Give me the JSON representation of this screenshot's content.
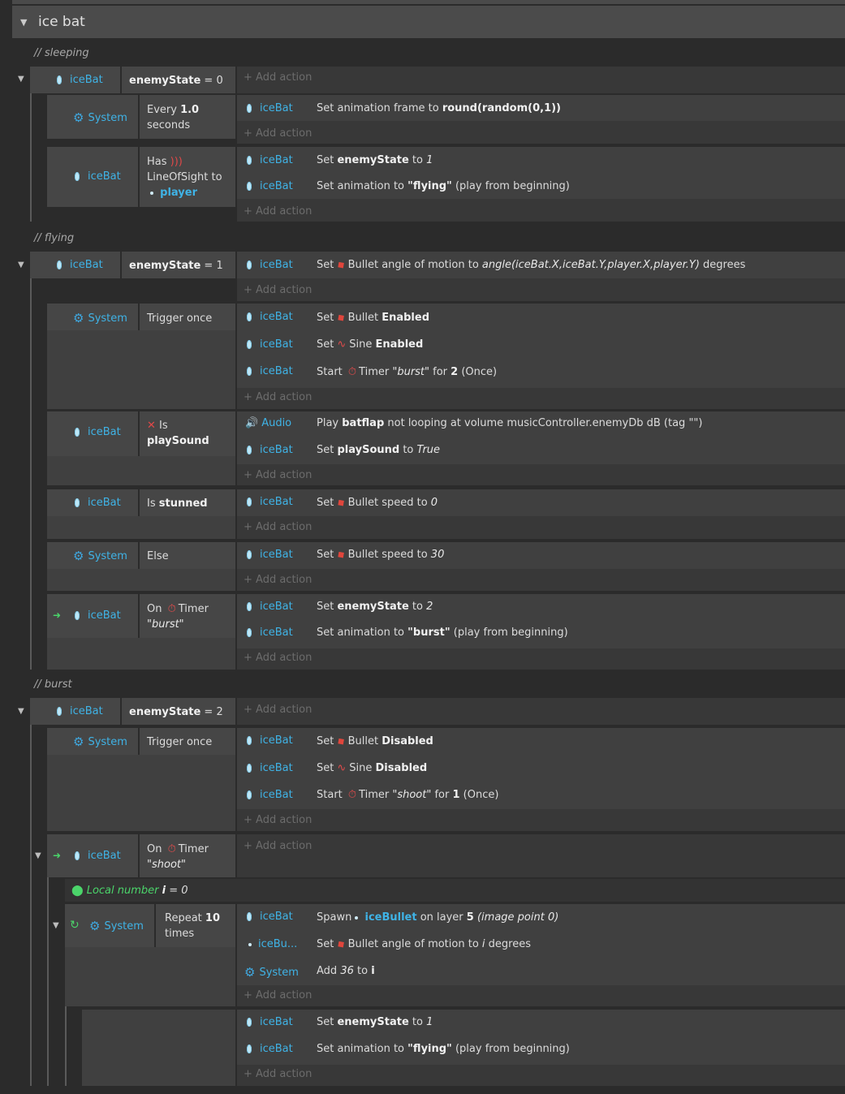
{
  "group": {
    "title": "ice bat"
  },
  "add_action": "+ Add action",
  "comments": {
    "sleeping": "// sleeping",
    "flying": "// flying",
    "burst": "// burst"
  },
  "names": {
    "icebat": "iceBat",
    "system": "System",
    "audio": "Audio",
    "icebullet_short": "iceBu..."
  },
  "sleeping": {
    "cond": {
      "var": "enemyState",
      "rest": " = 0"
    },
    "e1": {
      "c1": "Every ",
      "c2": "1.0",
      "c3": "seconds",
      "a1": {
        "p1": "Set animation frame to ",
        "p2": "round(random(0,1))"
      }
    },
    "e2": {
      "c1": "Has",
      "c2": "LineOfSight to",
      "c3": "player",
      "a1": {
        "p1": "Set ",
        "p2": "enemyState",
        "p3": " to ",
        "p4": "1"
      },
      "a2": {
        "p1": "Set animation to ",
        "p2": "\"flying\"",
        "p3": " (play from beginning)"
      }
    }
  },
  "flying": {
    "cond": {
      "var": "enemyState",
      "rest": " = 1"
    },
    "a1": {
      "p1": "Set",
      "p2": "Bullet angle of motion to ",
      "p3": "angle(iceBat.X,iceBat.Y,player.X,player.Y)",
      "p4": " degrees"
    },
    "e1": {
      "c1": "Trigger once",
      "a1": {
        "p1": "Set",
        "p2": "Bullet ",
        "p3": "Enabled"
      },
      "a2": {
        "p1": "Set",
        "p2": "Sine ",
        "p3": "Enabled"
      },
      "a3": {
        "p1": "Start",
        "p2": "Timer ",
        "p3": "\"burst\"",
        "p4": " for ",
        "p5": "2",
        "p6": " (Once)"
      }
    },
    "e2": {
      "c1": "Is",
      "c2": "playSound",
      "a1": {
        "p1": "Play ",
        "p2": "batflap",
        "p3": " not looping at volume musicController.enemyDb dB (tag \"\")"
      },
      "a2": {
        "p1": "Set ",
        "p2": "playSound",
        "p3": " to ",
        "p4": "True"
      }
    },
    "e3": {
      "c1": "Is ",
      "c2": "stunned",
      "a1": {
        "p1": "Set",
        "p2": "Bullet speed to ",
        "p3": "0"
      }
    },
    "e4": {
      "c1": "Else",
      "a1": {
        "p1": "Set",
        "p2": "Bullet speed to ",
        "p3": "30"
      }
    },
    "e5": {
      "c1": "On",
      "c2": "Timer",
      "c3": "\"burst\"",
      "a1": {
        "p1": "Set ",
        "p2": "enemyState",
        "p3": " to ",
        "p4": "2"
      },
      "a2": {
        "p1": "Set animation to ",
        "p2": "\"burst\"",
        "p3": " (play from beginning)"
      }
    }
  },
  "burst": {
    "cond": {
      "var": "enemyState",
      "rest": " = 2"
    },
    "e1": {
      "c1": "Trigger once",
      "a1": {
        "p1": "Set",
        "p2": "Bullet ",
        "p3": "Disabled"
      },
      "a2": {
        "p1": "Set",
        "p2": "Sine ",
        "p3": "Disabled"
      },
      "a3": {
        "p1": "Start",
        "p2": "Timer ",
        "p3": "\"shoot\"",
        "p4": " for ",
        "p5": "1",
        "p6": " (Once)"
      }
    },
    "e2": {
      "c1": "On",
      "c2": "Timer",
      "c3": "\"shoot\""
    },
    "local": {
      "p1": "Local number ",
      "p2": "i",
      "p3": " = 0"
    },
    "e3": {
      "c1": "Repeat ",
      "c2": "10",
      "c3": "times",
      "a1": {
        "p1": "Spawn ",
        "p2": "iceBullet",
        "p3": " on layer ",
        "p4": "5",
        "p5": " (image point 0)"
      },
      "a2": {
        "p1": "Set",
        "p2": "Bullet angle of motion to ",
        "p3": "i",
        "p4": " degrees"
      },
      "a3": {
        "p1": "Add ",
        "p2": "36",
        "p3": " to ",
        "p4": "i"
      }
    },
    "e4": {
      "a1": {
        "p1": "Set ",
        "p2": "enemyState",
        "p3": " to ",
        "p4": "1"
      },
      "a2": {
        "p1": "Set animation to ",
        "p2": "\"flying\"",
        "p3": " (play from beginning)"
      }
    }
  }
}
